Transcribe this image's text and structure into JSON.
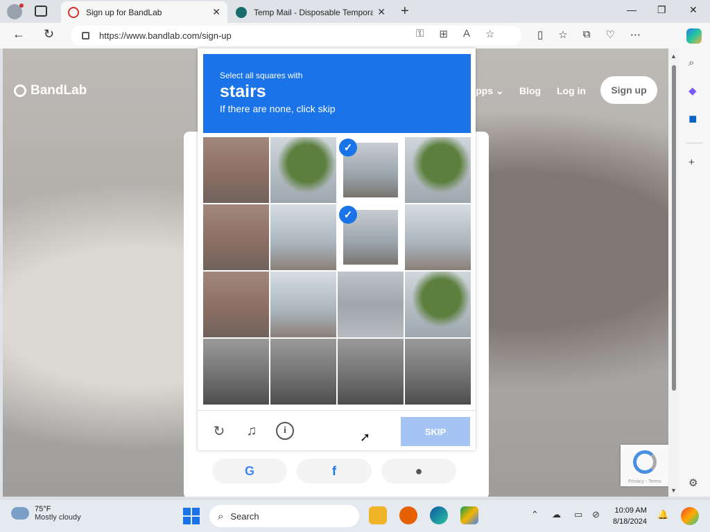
{
  "browser": {
    "tabs": [
      {
        "title": "Sign up for BandLab",
        "active": true
      },
      {
        "title": "Temp Mail - Disposable Tempora",
        "active": false
      }
    ],
    "url": "https://www.bandlab.com/sign-up",
    "icons": {
      "profile": "profile-icon",
      "close": "close-icon",
      "new_tab": "+",
      "back": "back-arrow-icon",
      "refresh": "refresh-icon"
    }
  },
  "site": {
    "brand": "BandLab",
    "nav": {
      "apps": "Apps",
      "blog": "Blog",
      "login": "Log in",
      "signup": "Sign up"
    },
    "social": [
      "G",
      "f",
      "apple-icon"
    ]
  },
  "captcha": {
    "instruction_line1": "Select all squares with",
    "target_word": "stairs",
    "instruction_line3": "If there are none, click skip",
    "header_color": "#1a73e8",
    "tiles": [
      {
        "type": "brick",
        "selected": false
      },
      {
        "type": "tree",
        "selected": false
      },
      {
        "type": "tree",
        "selected": true
      },
      {
        "type": "tree",
        "selected": false
      },
      {
        "type": "brick",
        "selected": false
      },
      {
        "type": "sky",
        "selected": false
      },
      {
        "type": "building",
        "selected": true
      },
      {
        "type": "sky",
        "selected": false
      },
      {
        "type": "brick",
        "selected": false
      },
      {
        "type": "sky",
        "selected": false
      },
      {
        "type": "building",
        "selected": false
      },
      {
        "type": "tree",
        "selected": false
      },
      {
        "type": "street",
        "selected": false
      },
      {
        "type": "street",
        "selected": false
      },
      {
        "type": "street",
        "selected": false
      },
      {
        "type": "street",
        "selected": false
      }
    ],
    "skip_label": "SKIP",
    "skip_color": "#a5c4f3"
  },
  "recaptcha": {
    "terms": "Privacy - Terms"
  },
  "taskbar": {
    "weather_temp": "75°F",
    "weather_desc": "Mostly cloudy",
    "search_label": "Search",
    "time": "10:09 AM",
    "date": "8/18/2024"
  }
}
